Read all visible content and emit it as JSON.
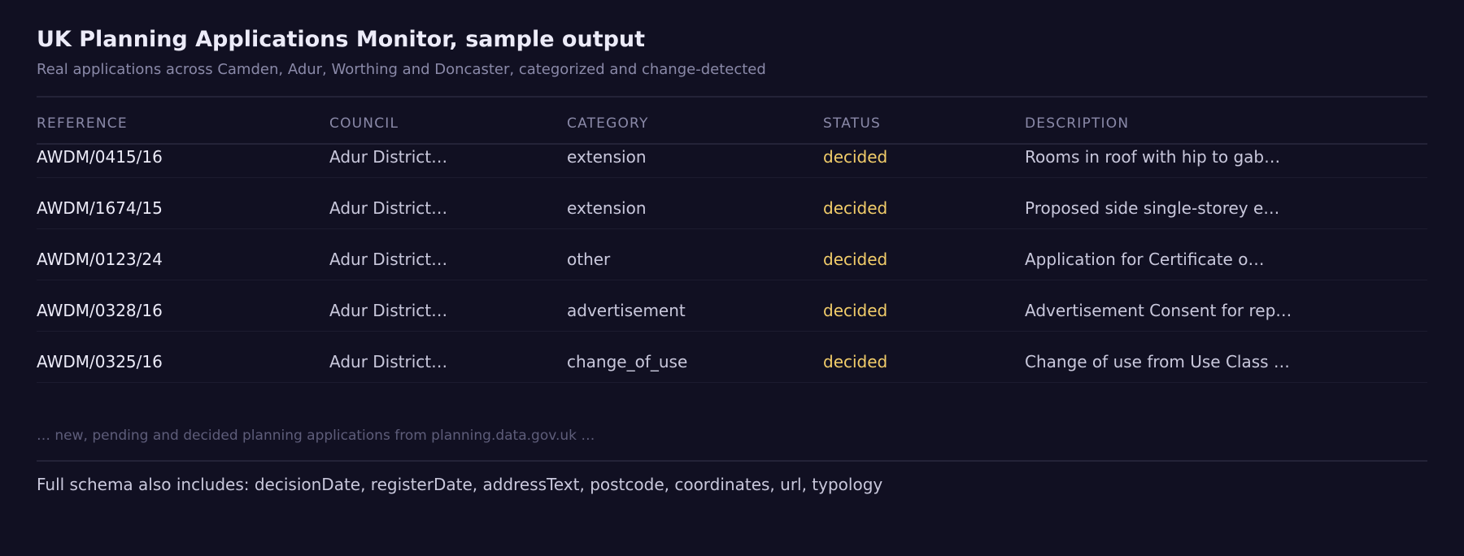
{
  "header": {
    "title": "UK Planning Applications Monitor, sample output",
    "subtitle": "Real applications across Camden, Adur, Worthing and Doncaster, categorized and change-detected"
  },
  "table": {
    "columns": [
      "REFERENCE",
      "COUNCIL",
      "CATEGORY",
      "STATUS",
      "DESCRIPTION"
    ],
    "rows": [
      {
        "reference": "AWDM/0415/16",
        "council": "Adur District…",
        "category": "extension",
        "status": "decided",
        "description": "Rooms in roof with hip to gab…"
      },
      {
        "reference": "AWDM/1674/15",
        "council": "Adur District…",
        "category": "extension",
        "status": "decided",
        "description": "Proposed side single-storey e…"
      },
      {
        "reference": "AWDM/0123/24",
        "council": "Adur District…",
        "category": "other",
        "status": "decided",
        "description": "Application for Certificate o…"
      },
      {
        "reference": "AWDM/0328/16",
        "council": "Adur District…",
        "category": "advertisement",
        "status": "decided",
        "description": "Advertisement Consent for rep…"
      },
      {
        "reference": "AWDM/0325/16",
        "council": "Adur District…",
        "category": "change_of_use",
        "status": "decided",
        "description": "Change of use from Use Class …"
      }
    ]
  },
  "footer": {
    "note": "… new, pending and decided planning applications from planning.data.gov.uk …",
    "schema": "Full schema also includes: decisionDate, registerDate, addressText, postcode, coordinates, url, typology"
  },
  "colors": {
    "background": "#111022",
    "text_primary": "#ecebf8",
    "text_muted": "#8a89a8",
    "status_decided": "#f2cd6a"
  }
}
